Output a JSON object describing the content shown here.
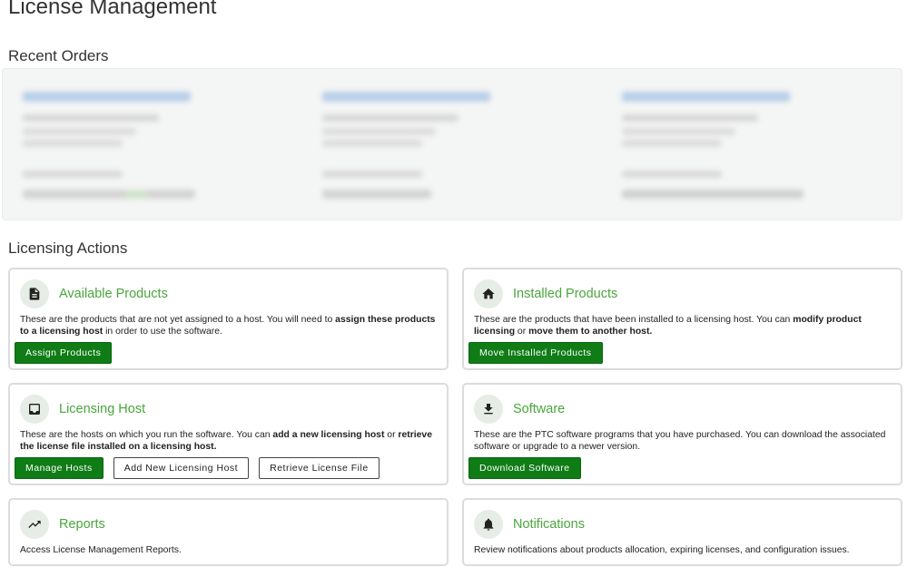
{
  "page": {
    "title": "License Management"
  },
  "recent_orders": {
    "heading": "Recent Orders"
  },
  "licensing_actions": {
    "heading": "Licensing Actions",
    "cards": [
      {
        "icon": "document-icon",
        "title": "Available Products",
        "desc_1": "These are the products that are not yet assigned to a host. You will need to ",
        "desc_2": "assign these products to a licensing host",
        "desc_3": " in order to use the software.",
        "buttons": [
          "Assign Products"
        ]
      },
      {
        "icon": "home-icon",
        "title": "Installed Products",
        "desc_1": "These are the products that have been installed to a licensing host. You can ",
        "desc_2": "modify product licensing",
        "desc_3": " or ",
        "desc_4": "move them to another host.",
        "buttons": [
          "Move Installed Products"
        ]
      },
      {
        "icon": "inbox-icon",
        "title": "Licensing Host",
        "desc_1": "These are the hosts on which you run the software. You can ",
        "desc_2": "add a new licensing host",
        "desc_3": " or ",
        "desc_4": "retrieve the license file installed on a licensing host.",
        "buttons": [
          "Manage Hosts",
          "Add New Licensing Host",
          "Retrieve License File"
        ]
      },
      {
        "icon": "download-icon",
        "title": "Software",
        "desc_1": "These are the PTC software programs that you have purchased. You can download the associated software or upgrade to a newer version.",
        "buttons": [
          "Download Software"
        ]
      },
      {
        "icon": "trending-up-icon",
        "title": "Reports",
        "desc_1": "Access License Management Reports."
      },
      {
        "icon": "bell-icon",
        "title": "Notifications",
        "desc_1": "Review notifications about products allocation, expiring licenses, and configuration issues."
      }
    ]
  },
  "colors": {
    "accent_green": "#49a63c",
    "button_green": "#0f7c16",
    "card_border": "#dcdcdc"
  }
}
